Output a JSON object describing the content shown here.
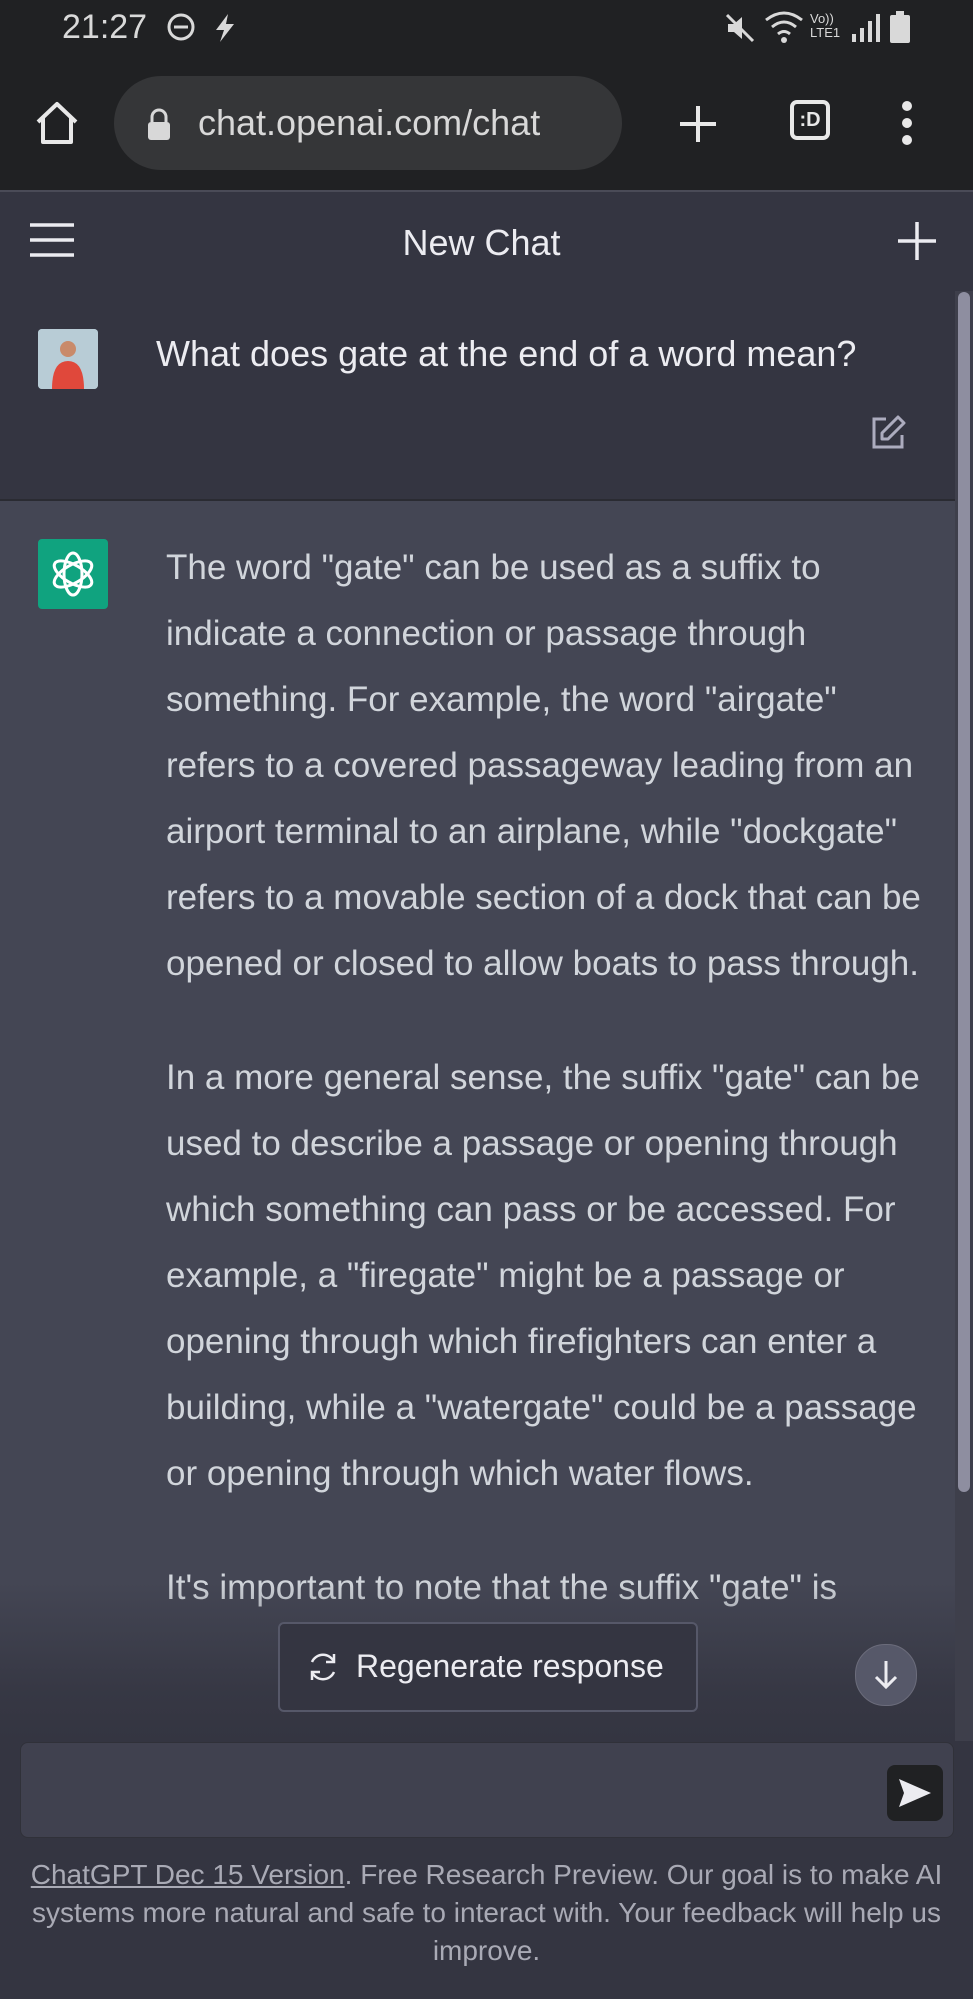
{
  "status_bar": {
    "time": "21:27",
    "icons": [
      "do-not-disturb-icon",
      "flash-icon",
      "mute-icon",
      "wifi-icon",
      "volte-icon",
      "signal-icon",
      "battery-icon"
    ],
    "volte_label": "Vo)) LTE1"
  },
  "browser": {
    "url": "chat.openai.com/chat",
    "tab_count": ":D",
    "icons": [
      "home-icon",
      "lock-icon",
      "new-tab-icon",
      "tabs-icon",
      "more-icon"
    ]
  },
  "app": {
    "title": "New Chat",
    "icons": [
      "menu-icon",
      "plus-icon"
    ]
  },
  "conversation": {
    "user_message": "What does gate at the end of a word mean?",
    "assistant_paragraphs": [
      "The word \"gate\" can be used as a suffix to indicate a connection or passage through something. For example, the word \"airgate\" refers to a covered passageway leading from an airport terminal to an airplane, while \"dockgate\" refers to a movable section of a dock that can be opened or closed to allow boats to pass through.",
      "In a more general sense, the suffix \"gate\" can be used to describe a passage or opening through which something can pass or be accessed. For example, a \"firegate\" might be a passage or opening through which firefighters can enter a building, while a \"watergate\" could be a passage or opening through which water flows.",
      "It's important to note that the suffix \"gate\" is"
    ]
  },
  "actions": {
    "regenerate_label": "Regenerate response"
  },
  "composer": {
    "placeholder": ""
  },
  "footer": {
    "version_link": "ChatGPT Dec 15 Version",
    "text": ". Free Research Preview. Our goal is to make AI systems more natural and safe to interact with. Your feedback will help us improve."
  },
  "colors": {
    "background": "#343541",
    "assistant_background": "#444654",
    "brand_green": "#10a37f",
    "text": "#ececf1"
  }
}
